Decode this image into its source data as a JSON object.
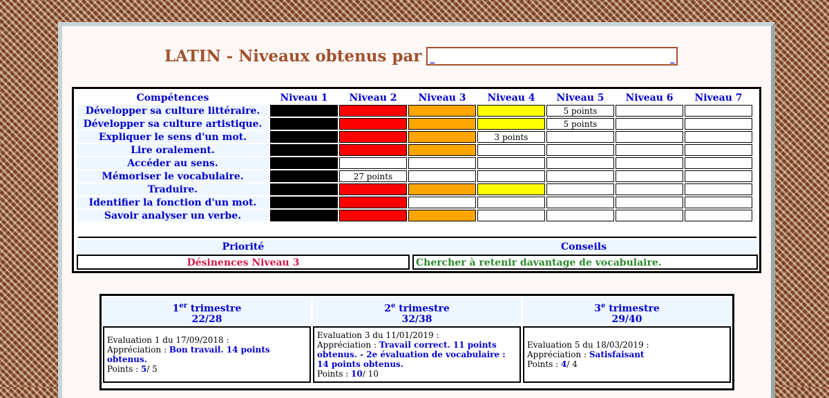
{
  "header": {
    "title": "LATIN - Niveaux obtenus par",
    "name_left": "_",
    "name_right": "_"
  },
  "grid": {
    "headers": [
      "Compétences",
      "Niveau 1",
      "Niveau 2",
      "Niveau 3",
      "Niveau 4",
      "Niveau 5",
      "Niveau 6",
      "Niveau 7"
    ],
    "rows": [
      {
        "label": "Développer sa culture littéraire.",
        "points": "5 points"
      },
      {
        "label": "Développer sa culture artistique.",
        "points": "5 points"
      },
      {
        "label": "Expliquer le sens d'un mot.",
        "points": "3 points"
      },
      {
        "label": "Lire oralement.",
        "points": ""
      },
      {
        "label": "Accéder au sens.",
        "points": ""
      },
      {
        "label": "Mémoriser le vocabulaire.",
        "points": "27 points"
      },
      {
        "label": "Traduire.",
        "points": ""
      },
      {
        "label": "Identifier la fonction d'un mot.",
        "points": ""
      },
      {
        "label": "Savoir analyser un verbe.",
        "points": ""
      }
    ]
  },
  "advice": {
    "priority_label": "Priorité",
    "advice_label": "Conseils",
    "priority_value": "Désinences Niveau 3",
    "advice_value": "Chercher à retenir davantage de vocabulaire."
  },
  "trimesters": [
    {
      "num": "1",
      "sup": "er",
      "label": "trimestre",
      "score": "22/28",
      "eval": "Evaluation 1 du 17/09/2018 :",
      "appr_label": "Appréciation : ",
      "appr": "Bon travail. 14 points obtenus.",
      "points_label": "Points : ",
      "points": "5",
      "max": "/ 5"
    },
    {
      "num": "2",
      "sup": "e",
      "label": "trimestre",
      "score": "32/38",
      "eval": "Evaluation 3 du 11/01/2019 :",
      "appr_label": "Appréciation : ",
      "appr": "Travail correct. 11 points obtenus. - 2e évaluation de vocabulaire : 14 points obtenus.",
      "points_label": "Points : ",
      "points": "10",
      "max": "/ 10"
    },
    {
      "num": "3",
      "sup": "e",
      "label": "trimestre",
      "score": "29/40",
      "eval": "Evaluation 5 du 18/03/2019 :",
      "appr_label": "Appréciation : ",
      "appr": "Satisfaisant",
      "points_label": "Points : ",
      "points": "4",
      "max": "/ 4"
    }
  ]
}
